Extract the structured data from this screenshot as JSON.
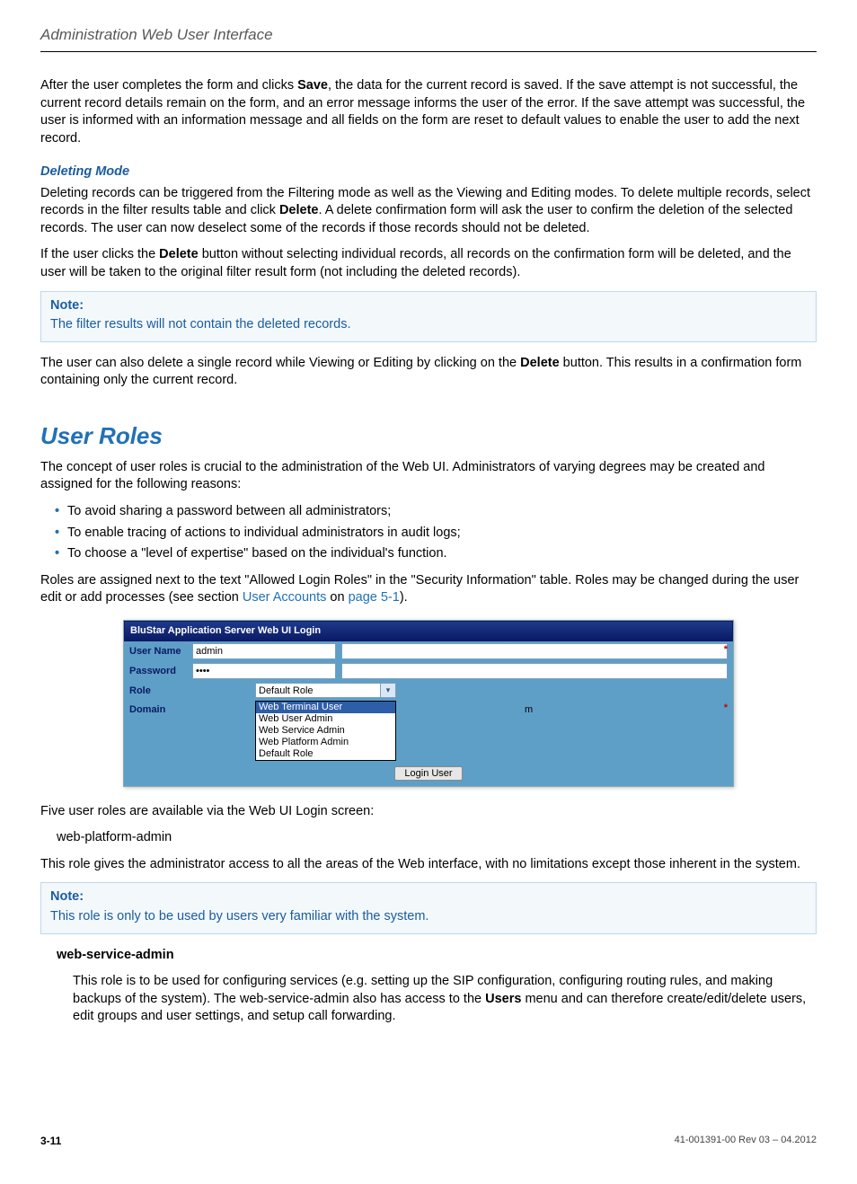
{
  "header": {
    "title": "Administration Web User Interface"
  },
  "intro": {
    "para1_a": "After the user completes the form and clicks ",
    "para1_bold": "Save",
    "para1_b": ", the data for the current record is saved. If the save attempt is not successful, the current record details remain on the form, and an error message informs the user of the error. If the save attempt was successful, the user is informed with an information message and all fields on the form are reset to default values to enable the user to add the next record."
  },
  "deleting": {
    "heading": "Deleting Mode",
    "p1_a": "Deleting records can be triggered from the Filtering mode as well as the Viewing and Editing modes. To delete multiple records, select records in the filter results table and click ",
    "p1_bold": "Delete",
    "p1_b": ". A delete confirmation form will ask the user to confirm the deletion of the selected records. The user can now deselect some of the records if those records should not be deleted.",
    "p2_a": "If the user clicks the ",
    "p2_bold": "Delete",
    "p2_b": " button without selecting individual records, all records on the confirmation form will be deleted, and the user will be taken to the original filter result form (not including the deleted records).",
    "note_label": "Note:",
    "note_text": "The filter results will not contain the deleted records.",
    "p3_a": "The user can also delete a single record while Viewing or Editing by clicking on the ",
    "p3_bold": "Delete",
    "p3_b": " button. This results in a confirmation form containing only the current record."
  },
  "roles": {
    "heading": "User Roles",
    "intro": "The concept of user roles is crucial to the administration of the Web UI. Administrators of varying degrees may be created and assigned for the following reasons:",
    "bullets": [
      "To avoid sharing a password between all administrators;",
      "To enable tracing of actions to individual administrators in audit logs;",
      "To choose a \"level of expertise\" based on the individual's function."
    ],
    "assign_a": "Roles are assigned next to the text \"Allowed Login Roles\" in the \"Security Information\" table. Roles may be changed during the user edit or add processes (see section ",
    "assign_link1": "User Accounts",
    "assign_mid": " on ",
    "assign_link2": "page 5-1",
    "assign_end": ").",
    "five_roles": "Five user roles are available via the Web UI Login screen:",
    "role1_name": "web-platform-admin",
    "role1_desc": "This role gives the administrator access to all the areas of the Web interface, with no limitations except those inherent in the system.",
    "note2_label": "Note:",
    "note2_text": "This role is only to be used by users very familiar with the system.",
    "role2_name": "web-service-admin",
    "role2_a": "This role is to be used for configuring services (e.g. setting up the SIP configuration, configuring routing rules, and making backups of the system). The web-service-admin also has access to the ",
    "role2_bold": "Users",
    "role2_b": " menu and can therefore create/edit/delete users, edit groups and user settings, and setup call forwarding."
  },
  "login": {
    "title": "BluStar Application Server Web UI Login",
    "labels": {
      "username": "User Name",
      "password": "Password",
      "role": "Role",
      "domain": "Domain"
    },
    "username_value": "admin",
    "password_value": "••••",
    "role_selected": "Default Role",
    "role_options": [
      "Web Terminal User",
      "Web User Admin",
      "Web Service Admin",
      "Web Platform Admin",
      "Default Role"
    ],
    "domain_trail": "m",
    "button": "Login User"
  },
  "footer": {
    "page": "3-11",
    "docid": "41-001391-00 Rev 03 – 04.2012"
  }
}
